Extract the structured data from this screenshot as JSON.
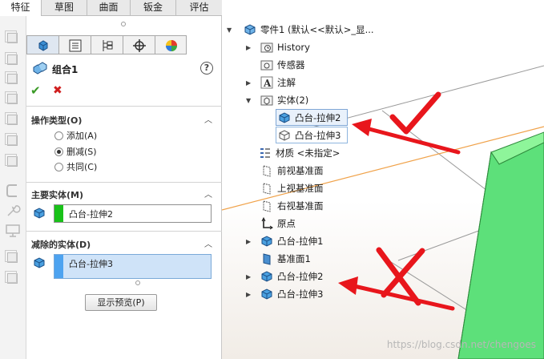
{
  "tabs": [
    "特征",
    "草图",
    "曲面",
    "钣金",
    "评估"
  ],
  "feature": {
    "title": "组合1"
  },
  "operation": {
    "header": "操作类型(O)",
    "options": [
      "添加(A)",
      "删减(S)",
      "共同(C)"
    ],
    "selected": "删减(S)"
  },
  "main_body": {
    "header": "主要实体(M)",
    "value": "凸台-拉伸2",
    "swatch": "#19c219"
  },
  "subtract_body": {
    "header": "减除的实体(D)",
    "value": "凸台-拉伸3",
    "swatch": "#4da3f0"
  },
  "preview_button": "显示预览(P)",
  "tree": {
    "root": "零件1 (默认<<默认>_显...",
    "history": "History",
    "sensors": "传感器",
    "annotations": "注解",
    "solid_bodies": "实体(2)",
    "body_1": "凸台-拉伸2",
    "body_2": "凸台-拉伸3",
    "material": "材质 <未指定>",
    "front_plane": "前视基准面",
    "top_plane": "上视基准面",
    "right_plane": "右视基准面",
    "origin": "原点",
    "feature_1": "凸台-拉伸1",
    "plane_1": "基准面1",
    "feature_2": "凸台-拉伸2",
    "feature_3": "凸台-拉伸3"
  },
  "watermark": "https://blog.csdn.net/chengoes",
  "colors": {
    "annotation_red": "#e8161c",
    "body_green": "#5de07a"
  }
}
